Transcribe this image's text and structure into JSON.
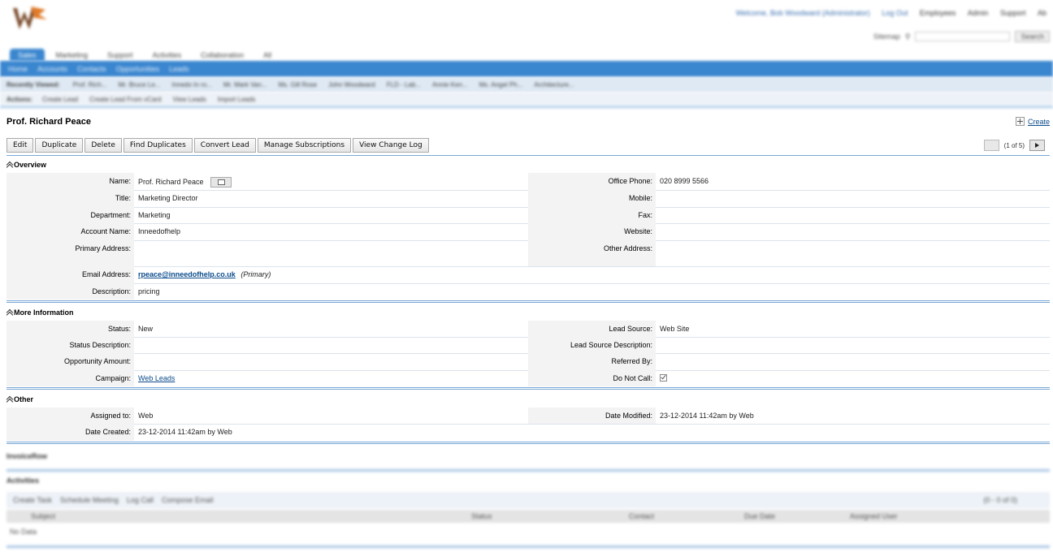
{
  "header": {
    "topright": [
      "Welcome, Bob Woodward (Administrator)",
      "Log Out",
      "Employees",
      "Admin",
      "Support",
      "Ab"
    ],
    "sitemap_label": "Sitemap",
    "search_placeholder": "",
    "search_button": "Search"
  },
  "tabs": [
    "Sales",
    "Marketing",
    "Support",
    "Activities",
    "Collaboration",
    "All"
  ],
  "subtabs": [
    "Home",
    "Accounts",
    "Contacts",
    "Opportunities",
    "Leads"
  ],
  "recent": {
    "label": "Recently Viewed:",
    "items": [
      "Prof. Rich...",
      "Mr. Bruce Le...",
      "Innedo In ro...",
      "Mr. Mark Van...",
      "Ms. Gill Rose",
      "John Woodward",
      "FLD - Lab...",
      "Annie Ken...",
      "Ms. Angel Ph...",
      "Architecture..."
    ]
  },
  "actions_bar": {
    "label": "Actions:",
    "items": [
      "Create Lead",
      "Create Lead From vCard",
      "View Leads",
      "Import Leads"
    ]
  },
  "record": {
    "title": "Prof. Richard Peace",
    "create_label": "Create",
    "buttons": [
      "Edit",
      "Duplicate",
      "Delete",
      "Find Duplicates",
      "Convert Lead",
      "Manage Subscriptions",
      "View Change Log"
    ],
    "pager": "(1 of 5)"
  },
  "overview": {
    "heading": "Overview",
    "name_label": "Name:",
    "name": "Prof. Richard Peace",
    "office_phone_label": "Office Phone:",
    "office_phone": "020 8999 5566",
    "title_label": "Title:",
    "title": "Marketing Director",
    "mobile_label": "Mobile:",
    "mobile": "",
    "department_label": "Department:",
    "department": "Marketing",
    "fax_label": "Fax:",
    "fax": "",
    "account_label": "Account Name:",
    "account": "Inneedofhelp",
    "website_label": "Website:",
    "website": "",
    "primary_address_label": "Primary Address:",
    "primary_address": "",
    "other_address_label": "Other Address:",
    "other_address": "",
    "email_label": "Email Address:",
    "email": "rpeace@inneedofhelp.co.uk",
    "email_tag": "(Primary)",
    "description_label": "Description:",
    "description": "pricing"
  },
  "more_info": {
    "heading": "More Information",
    "status_label": "Status:",
    "status": "New",
    "lead_source_label": "Lead Source:",
    "lead_source": "Web Site",
    "status_desc_label": "Status Description:",
    "status_desc": "",
    "lead_source_desc_label": "Lead Source Description:",
    "lead_source_desc": "",
    "opp_amount_label": "Opportunity Amount:",
    "opp_amount": "",
    "referred_by_label": "Referred By:",
    "referred_by": "",
    "campaign_label": "Campaign:",
    "campaign": "Web Leads",
    "do_not_call_label": "Do Not Call:",
    "do_not_call": false
  },
  "other": {
    "heading": "Other",
    "assigned_label": "Assigned to:",
    "assigned": "Web",
    "modified_label": "Date Modified:",
    "modified": "23-12-2014 11:42am by Web",
    "created_label": "Date Created:",
    "created": "23-12-2014 11:42am by Web"
  },
  "subpanels": {
    "invoice_heading": "InvoiceRow",
    "activities_heading": "Activities",
    "activity_buttons": [
      "Create Task",
      "Schedule Meeting",
      "Log Call",
      "Compose Email"
    ],
    "pager": "(0 - 0 of 0)",
    "columns": [
      "Subject",
      "Status",
      "Contact",
      "Due Date",
      "Assigned User"
    ],
    "empty": "No Data"
  },
  "colors": {
    "accent": "#3a86cf",
    "link": "#0b4c8c",
    "rule": "#7aa7d6"
  }
}
